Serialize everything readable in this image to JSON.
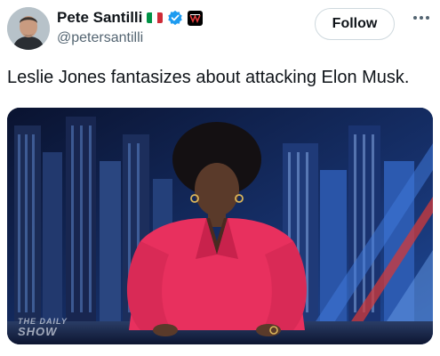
{
  "author": {
    "name": "Pete Santilli",
    "handle": "@petersantilli",
    "flag_icon": "italy-flag-icon",
    "verified_icon": "verified-badge-icon",
    "affiliation_icon": "affiliate-badge-icon"
  },
  "actions": {
    "follow_label": "Follow",
    "more_icon": "more-options-icon"
  },
  "tweet": {
    "text": "Leslie Jones fantasizes about attacking Elon Musk."
  },
  "media": {
    "watermark_line1": "THE DAILY",
    "watermark_line2": "SHOW"
  },
  "colors": {
    "verified_blue": "#1d9bf0",
    "jacket_pink": "#e8305e",
    "background_navy": "#0b1430"
  }
}
